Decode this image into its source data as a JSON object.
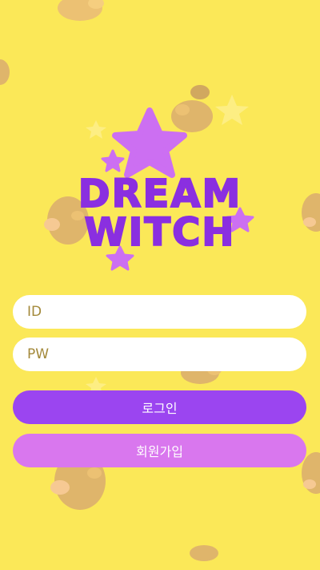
{
  "app": {
    "logo_line1": "DREAM",
    "logo_line2": "WITCH"
  },
  "form": {
    "id_placeholder": "ID",
    "pw_placeholder": "PW",
    "login_label": "로그인",
    "signup_label": "회원가입"
  },
  "colors": {
    "background": "#fbe858",
    "logo_text": "#8a2fe0",
    "star": "#cc6ff2",
    "login_button": "#9b45f0",
    "signup_button": "#d977ee"
  }
}
